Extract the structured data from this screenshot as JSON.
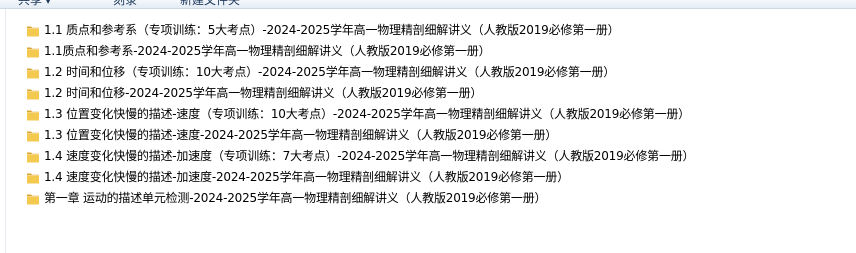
{
  "toolbar": {
    "share_label": "共享",
    "burn_label": "刻录",
    "new_folder_label": "新建文件夹"
  },
  "colors": {
    "folder_yellow": "#f4c94f",
    "folder_dark": "#d9a532",
    "text": "#000000"
  },
  "files": [
    {
      "name": "1.1 质点和参考系（专项训练：5大考点）-2024-2025学年高一物理精剖细解讲义（人教版2019必修第一册）",
      "icon": "folder-icon"
    },
    {
      "name": "1.1质点和参考系-2024-2025学年高一物理精剖细解讲义（人教版2019必修第一册）",
      "icon": "folder-icon"
    },
    {
      "name": "1.2 时间和位移（专项训练：10大考点）-2024-2025学年高一物理精剖细解讲义（人教版2019必修第一册）",
      "icon": "folder-icon"
    },
    {
      "name": "1.2 时间和位移-2024-2025学年高一物理精剖细解讲义（人教版2019必修第一册）",
      "icon": "folder-icon"
    },
    {
      "name": "1.3 位置变化快慢的描述-速度（专项训练：10大考点）-2024-2025学年高一物理精剖细解讲义（人教版2019必修第一册）",
      "icon": "folder-icon"
    },
    {
      "name": "1.3 位置变化快慢的描述-速度-2024-2025学年高一物理精剖细解讲义（人教版2019必修第一册）",
      "icon": "folder-icon"
    },
    {
      "name": "1.4 速度变化快慢的描述-加速度（专项训练：7大考点）-2024-2025学年高一物理精剖细解讲义（人教版2019必修第一册）",
      "icon": "folder-icon"
    },
    {
      "name": "1.4 速度变化快慢的描述-加速度-2024-2025学年高一物理精剖细解讲义（人教版2019必修第一册）",
      "icon": "folder-icon"
    },
    {
      "name": "第一章 运动的描述单元检测-2024-2025学年高一物理精剖细解讲义（人教版2019必修第一册）",
      "icon": "folder-icon"
    }
  ]
}
